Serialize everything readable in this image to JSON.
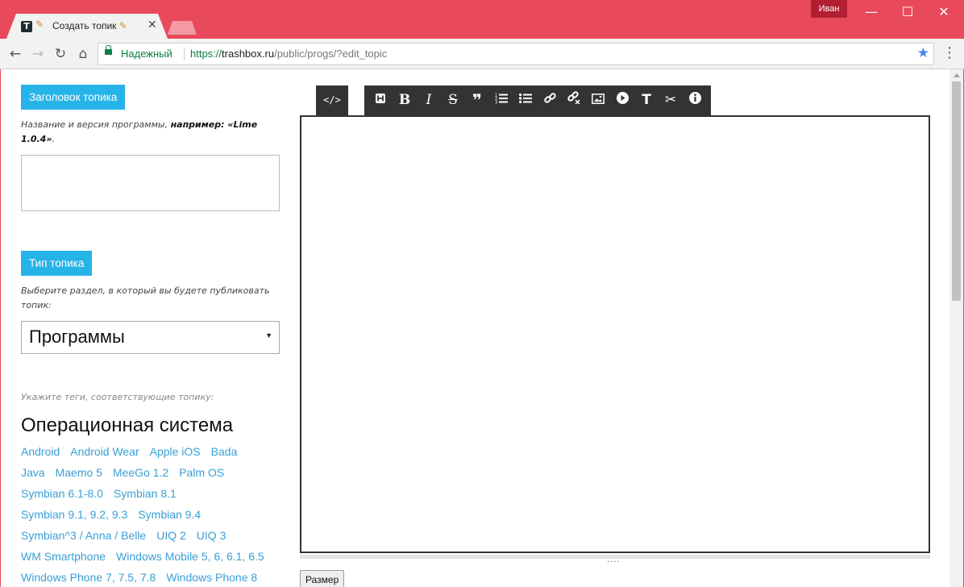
{
  "browser": {
    "tab_title": "Создать топик",
    "profile_name": "Иван",
    "omnibox": {
      "secure_label": "Надежный",
      "url_scheme": "https://",
      "url_host": "trashbox.ru",
      "url_path": "/public/progs/?edit_topic"
    },
    "accent_color": "#e84a5c"
  },
  "form": {
    "title_section": {
      "button_label": "Заголовок топика",
      "hint_prefix": "Название и версия программы, ",
      "hint_example": "например: «Lime 1.0.4»",
      "hint_suffix": "."
    },
    "type_section": {
      "button_label": "Тип топика",
      "hint": "Выберите раздел, в который вы будете публиковать топик:",
      "selected": "Программы"
    },
    "tags_hint": "Укажите теги, соответствующие топику:",
    "os_heading": "Операционная система",
    "tag_rows": [
      [
        "Android",
        "Android Wear",
        "Apple iOS",
        "Bada"
      ],
      [
        "Java",
        "Maemo 5",
        "MeeGo 1.2",
        "Palm OS"
      ],
      [
        "Symbian 6.1-8.0",
        "Symbian 8.1"
      ],
      [
        "Symbian 9.1, 9.2, 9.3",
        "Symbian 9.4"
      ],
      [
        "Symbian^3 / Anna / Belle",
        "UIQ 2",
        "UIQ 3"
      ],
      [
        "WM Smartphone",
        "Windows Mobile 5, 6, 6.1, 6.5"
      ],
      [
        "Windows Phone 7, 7.5, 7.8",
        "Windows Phone 8"
      ]
    ]
  },
  "editor": {
    "source_label": "</>",
    "toolbar_icons": [
      "heading-icon",
      "bold-icon",
      "italic-icon",
      "strikethrough-icon",
      "quote-icon",
      "ordered-list-icon",
      "unordered-list-icon",
      "link-icon",
      "unlink-icon",
      "image-icon",
      "video-icon",
      "text-format-icon",
      "cut-icon",
      "info-icon"
    ],
    "size_button": "Размер"
  }
}
